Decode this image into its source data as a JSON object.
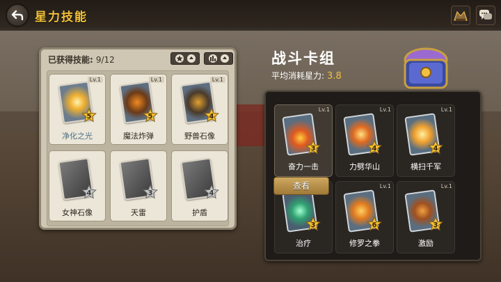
{
  "header": {
    "title": "星力技能",
    "icons": [
      "back-arrow-icon",
      "ranking-icon",
      "chat-icon"
    ]
  },
  "left_panel": {
    "acquired_label": "已获得技能:",
    "acquired_count": "9/12",
    "sort_buttons": [
      "star-sort-icon",
      "bar-sort-icon"
    ],
    "skills": [
      {
        "name": "净化之光",
        "level": "Lv.1",
        "stars": "5",
        "art": "light-burst-icon",
        "locked": false,
        "name_color": "#4a6f86"
      },
      {
        "name": "魔法炸弹",
        "level": "Lv.1",
        "stars": "5",
        "art": "pumpkin-bomb-icon",
        "locked": false,
        "name_color": "#2b241c"
      },
      {
        "name": "野兽石像",
        "level": "Lv.1",
        "stars": "4",
        "art": "beast-statue-icon",
        "locked": false,
        "name_color": "#2b241c"
      },
      {
        "name": "女神石像",
        "level": "",
        "stars": "4",
        "art": "goddess-statue-icon",
        "locked": true,
        "name_color": "#2b241c"
      },
      {
        "name": "天雷",
        "level": "",
        "stars": "3",
        "art": "lightning-icon",
        "locked": true,
        "name_color": "#2b241c"
      },
      {
        "name": "护盾",
        "level": "",
        "stars": "4",
        "art": "shield-icon",
        "locked": true,
        "name_color": "#2b241c"
      }
    ]
  },
  "deck": {
    "title": "战斗卡组",
    "avg_label": "平均消耗星力:",
    "avg_value": "3.8",
    "view_button": "查看",
    "cards": [
      {
        "name": "奋力一击",
        "level": "Lv.1",
        "stars": "3",
        "art": "sword-strike-icon",
        "selected": true
      },
      {
        "name": "力劈华山",
        "level": "Lv.1",
        "stars": "4",
        "art": "cleave-icon",
        "selected": false
      },
      {
        "name": "横扫千军",
        "level": "Lv.1",
        "stars": "4",
        "art": "sweep-icon",
        "selected": false
      },
      {
        "name": "治疗",
        "level": "",
        "stars": "3",
        "art": "heal-icon",
        "selected": false
      },
      {
        "name": "修罗之拳",
        "level": "Lv.1",
        "stars": "6",
        "art": "fist-icon",
        "selected": false
      },
      {
        "name": "激励",
        "level": "Lv.1",
        "stars": "3",
        "art": "horn-icon",
        "selected": false
      }
    ]
  },
  "colors": {
    "title_gold": "#f3c23a",
    "panel_light": "#cfc7b4",
    "panel_dark": "#1e1b18",
    "star_gold": "#f2c230",
    "star_gray": "#c8c8c8"
  }
}
